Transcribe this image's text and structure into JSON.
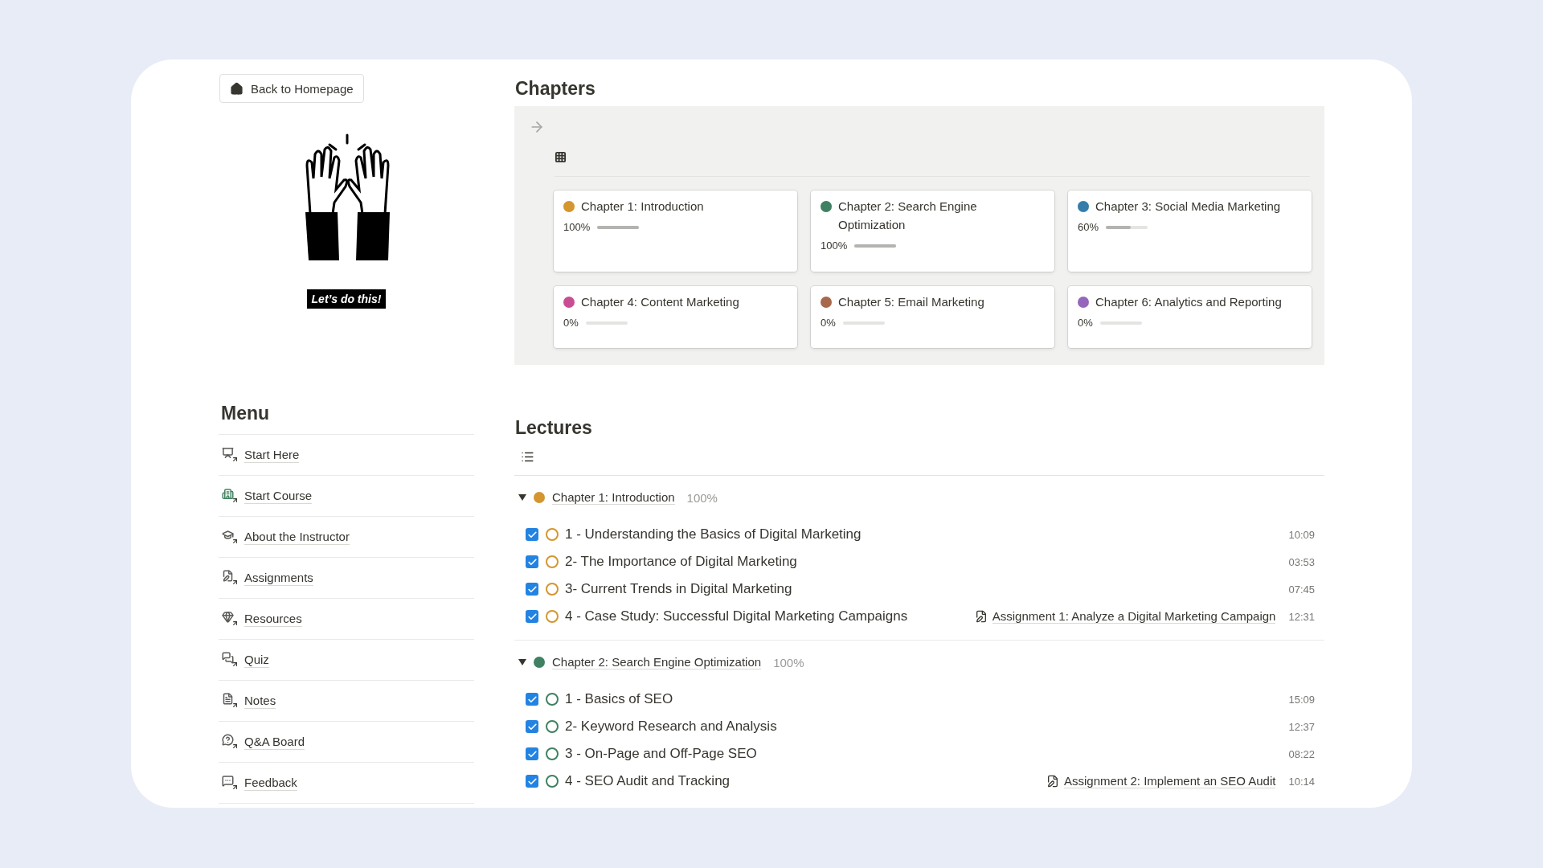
{
  "back_button": {
    "label": "Back to Homepage"
  },
  "banner": {
    "label": "Let’s do this!"
  },
  "menu": {
    "title": "Menu",
    "items": [
      {
        "label": "Start Here"
      },
      {
        "label": "Start Course"
      },
      {
        "label": "About the Instructor"
      },
      {
        "label": "Assignments"
      },
      {
        "label": "Resources"
      },
      {
        "label": "Quiz"
      },
      {
        "label": "Notes"
      },
      {
        "label": "Q&A Board"
      },
      {
        "label": "Feedback"
      }
    ]
  },
  "chapters": {
    "title": "Chapters",
    "cards": [
      {
        "title": "Chapter 1: Introduction",
        "color": "#d4962e",
        "percent": "100%",
        "level": 1
      },
      {
        "title": "Chapter 2: Search Engine Optimization",
        "color": "#3f8162",
        "percent": "100%",
        "level": 1
      },
      {
        "title": "Chapter 3: Social Media Marketing",
        "color": "#357dab",
        "percent": "60%",
        "level": 0.6
      },
      {
        "title": "Chapter 4: Content Marketing",
        "color": "#c94d93",
        "percent": "0%",
        "level": 0
      },
      {
        "title": "Chapter 5: Email Marketing",
        "color": "#a7684b",
        "percent": "0%",
        "level": 0
      },
      {
        "title": "Chapter 6: Analytics and Reporting",
        "color": "#9467bd",
        "percent": "0%",
        "level": 0
      }
    ]
  },
  "lectures": {
    "title": "Lectures",
    "groups": [
      {
        "title": "Chapter 1: Introduction",
        "color": "#d4962e",
        "percent": "100%",
        "expanded": true,
        "rows": [
          {
            "title": "1 - Understanding the Basics of Digital Marketing",
            "checked": true,
            "duration": "10:09"
          },
          {
            "title": "2- The Importance of Digital Marketing",
            "checked": true,
            "duration": "03:53"
          },
          {
            "title": "3- Current Trends in Digital Marketing",
            "checked": true,
            "duration": "07:45"
          },
          {
            "title": "4 - Case Study: Successful Digital Marketing Campaigns",
            "checked": true,
            "assignment": "Assignment 1: Analyze a Digital Marketing Campaign",
            "duration": "12:31"
          }
        ]
      },
      {
        "title": "Chapter 2: Search Engine Optimization",
        "color": "#3f8162",
        "percent": "100%",
        "expanded": true,
        "rows": [
          {
            "title": "1 - Basics of SEO",
            "checked": true,
            "duration": "15:09"
          },
          {
            "title": "2- Keyword Research and Analysis",
            "checked": true,
            "duration": "12:37"
          },
          {
            "title": "3 - On-Page and Off-Page SEO",
            "checked": true,
            "duration": "08:22"
          },
          {
            "title": "4 - SEO Audit and Tracking",
            "checked": true,
            "assignment": "Assignment 2: Implement an SEO Audit",
            "duration": "10:14"
          }
        ]
      }
    ]
  }
}
